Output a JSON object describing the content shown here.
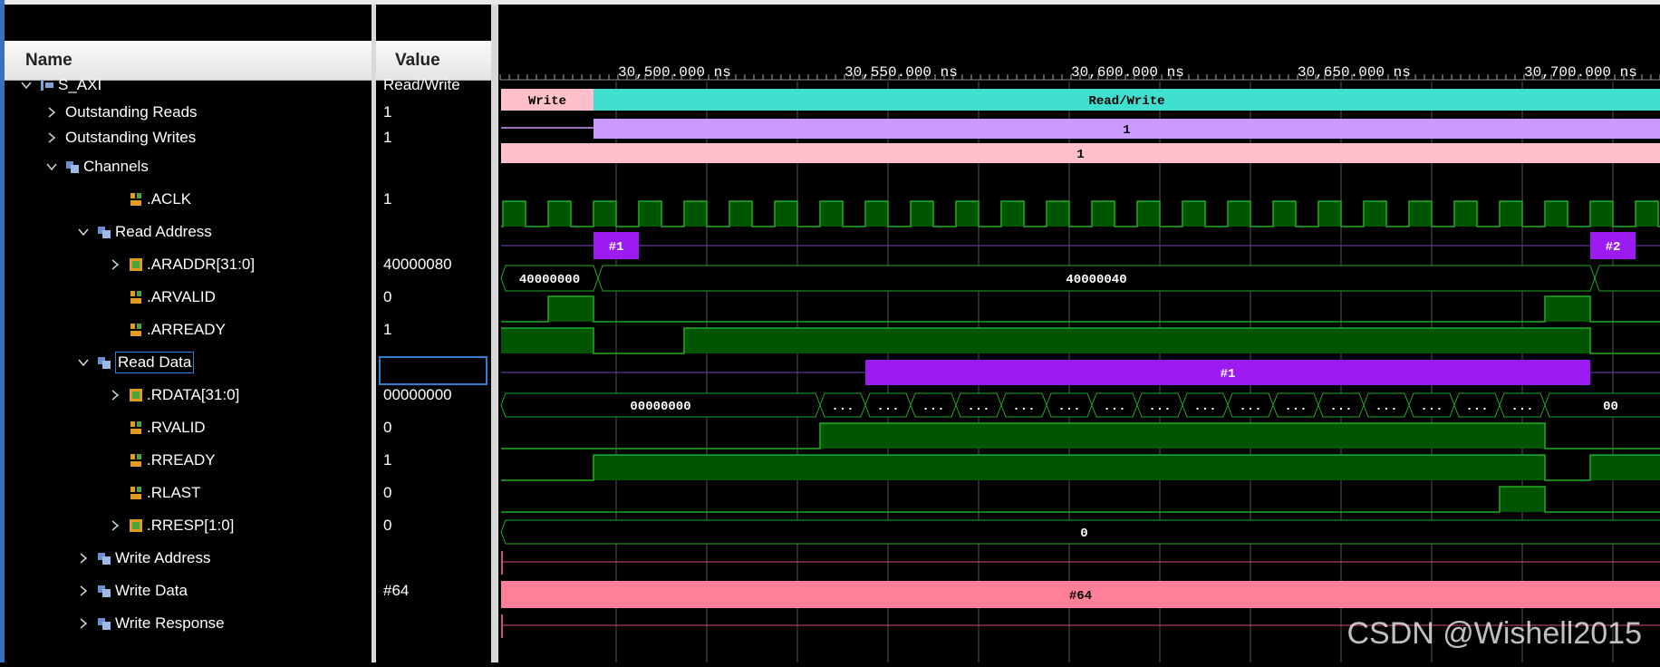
{
  "columns": {
    "name": "Name",
    "value": "Value"
  },
  "rows": [
    {
      "label": "S_AXI",
      "value": "Read/Write",
      "indent": 0,
      "chev": "down",
      "icon": "interface"
    },
    {
      "label": "Outstanding Reads",
      "value": "1",
      "indent": 1,
      "chev": "right",
      "icon": "none"
    },
    {
      "label": "Outstanding Writes",
      "value": "1",
      "indent": 1,
      "chev": "right",
      "icon": "none"
    },
    {
      "label": "Channels",
      "value": "",
      "indent": 1,
      "chev": "down",
      "icon": "group"
    },
    {
      "label": ".ACLK",
      "value": "1",
      "indent": 3,
      "chev": "none",
      "icon": "wire"
    },
    {
      "label": "Read Address",
      "value": "",
      "indent": 2,
      "chev": "down",
      "icon": "group"
    },
    {
      "label": ".ARADDR[31:0]",
      "value": "40000080",
      "indent": 3,
      "chev": "right",
      "icon": "bus"
    },
    {
      "label": ".ARVALID",
      "value": "0",
      "indent": 3,
      "chev": "none",
      "icon": "wire"
    },
    {
      "label": ".ARREADY",
      "value": "1",
      "indent": 3,
      "chev": "none",
      "icon": "wire"
    },
    {
      "label": "Read Data",
      "value": "",
      "indent": 2,
      "chev": "down",
      "icon": "group"
    },
    {
      "label": ".RDATA[31:0]",
      "value": "00000000",
      "indent": 3,
      "chev": "right",
      "icon": "bus"
    },
    {
      "label": ".RVALID",
      "value": "0",
      "indent": 3,
      "chev": "none",
      "icon": "wire"
    },
    {
      "label": ".RREADY",
      "value": "1",
      "indent": 3,
      "chev": "none",
      "icon": "wire"
    },
    {
      "label": ".RLAST",
      "value": "0",
      "indent": 3,
      "chev": "none",
      "icon": "wire"
    },
    {
      "label": ".RRESP[1:0]",
      "value": "0",
      "indent": 3,
      "chev": "right",
      "icon": "bus"
    },
    {
      "label": "Write Address",
      "value": "",
      "indent": 2,
      "chev": "right",
      "icon": "group"
    },
    {
      "label": "Write Data",
      "value": "#64",
      "indent": 2,
      "chev": "right",
      "icon": "group"
    },
    {
      "label": "Write Response",
      "value": "",
      "indent": 2,
      "chev": "right",
      "icon": "group"
    }
  ],
  "timescale": [
    "30,500.000 ns",
    "30,550.000 ns",
    "30,600.000 ns",
    "30,650.000 ns",
    "30,700.000 ns"
  ],
  "waves": {
    "state": [
      "Write",
      "Read/Write"
    ],
    "outstanding_reads": "1",
    "outstanding_writes": "1",
    "araddr": [
      "40000000",
      "40000040"
    ],
    "arid_markers": [
      "#1",
      "#2"
    ],
    "rdata_first": "00000000",
    "rdata_last": "00",
    "rdata_beats": "...",
    "rid_marker": "#1",
    "rresp": "0",
    "write_data": "#64"
  },
  "colors": {
    "clock": "#22aa22",
    "signal_fill": "#005500",
    "state_write": "#ffc0cb",
    "state_rw": "#40e0d0",
    "outstanding_reads": "#cc99ff",
    "outstanding_writes": "#ffc0cb",
    "id_marker": "#9b1bf0",
    "write_data": "#ff7f99"
  },
  "watermark": "CSDN @Wishell2015"
}
